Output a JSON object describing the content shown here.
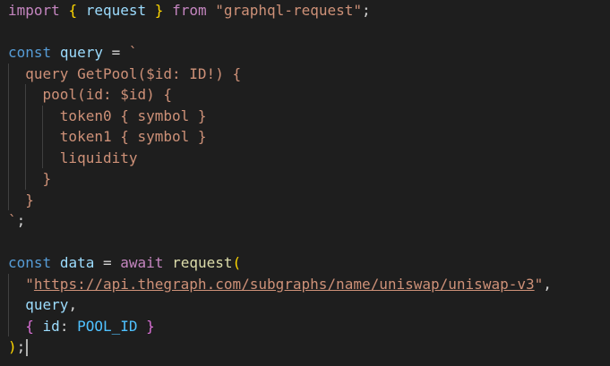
{
  "editor": {
    "language": "javascript",
    "theme": "dark",
    "colors": {
      "background": "#1e1e1e",
      "keyword_control": "#c586c0",
      "keyword_storage": "#569cd6",
      "variable": "#9cdcfe",
      "constant": "#4fc1ff",
      "function": "#dcdcaa",
      "string": "#ce9178",
      "bracket_level1": "#ffd700",
      "bracket_level2": "#da70d6"
    },
    "lines": [
      {
        "indent_guides": 0,
        "tokens": [
          {
            "t": "import",
            "c": "kw"
          },
          {
            "t": " ",
            "c": "punc"
          },
          {
            "t": "{",
            "c": "br1"
          },
          {
            "t": " ",
            "c": "punc"
          },
          {
            "t": "request",
            "c": "var"
          },
          {
            "t": " ",
            "c": "punc"
          },
          {
            "t": "}",
            "c": "br1"
          },
          {
            "t": " ",
            "c": "punc"
          },
          {
            "t": "from",
            "c": "kw"
          },
          {
            "t": " ",
            "c": "punc"
          },
          {
            "t": "\"graphql-request\"",
            "c": "str"
          },
          {
            "t": ";",
            "c": "punc"
          }
        ]
      },
      {
        "indent_guides": 0,
        "tokens": []
      },
      {
        "indent_guides": 0,
        "tokens": [
          {
            "t": "const",
            "c": "kw2"
          },
          {
            "t": " ",
            "c": "punc"
          },
          {
            "t": "query",
            "c": "var"
          },
          {
            "t": " = ",
            "c": "punc"
          },
          {
            "t": "`",
            "c": "str"
          }
        ]
      },
      {
        "indent_guides": 1,
        "tokens": [
          {
            "t": "  query GetPool($id: ID!) {",
            "c": "str"
          }
        ]
      },
      {
        "indent_guides": 2,
        "tokens": [
          {
            "t": "    pool(id: $id) {",
            "c": "str"
          }
        ]
      },
      {
        "indent_guides": 3,
        "tokens": [
          {
            "t": "      token0 { symbol }",
            "c": "str"
          }
        ]
      },
      {
        "indent_guides": 3,
        "tokens": [
          {
            "t": "      token1 { symbol }",
            "c": "str"
          }
        ]
      },
      {
        "indent_guides": 3,
        "tokens": [
          {
            "t": "      liquidity",
            "c": "str"
          }
        ]
      },
      {
        "indent_guides": 2,
        "tokens": [
          {
            "t": "    }",
            "c": "str"
          }
        ]
      },
      {
        "indent_guides": 1,
        "tokens": [
          {
            "t": "  }",
            "c": "str"
          }
        ]
      },
      {
        "indent_guides": 0,
        "tokens": [
          {
            "t": "`",
            "c": "str"
          },
          {
            "t": ";",
            "c": "punc"
          }
        ]
      },
      {
        "indent_guides": 0,
        "tokens": []
      },
      {
        "indent_guides": 0,
        "tokens": [
          {
            "t": "const",
            "c": "kw2"
          },
          {
            "t": " ",
            "c": "punc"
          },
          {
            "t": "data",
            "c": "var"
          },
          {
            "t": " = ",
            "c": "punc"
          },
          {
            "t": "await",
            "c": "kw"
          },
          {
            "t": " ",
            "c": "punc"
          },
          {
            "t": "request",
            "c": "fn"
          },
          {
            "t": "(",
            "c": "br1"
          }
        ]
      },
      {
        "indent_guides": 1,
        "tokens": [
          {
            "t": "  ",
            "c": "punc"
          },
          {
            "t": "\"",
            "c": "str"
          },
          {
            "t": "https://api.thegraph.com/subgraphs/name/uniswap/uniswap-v3",
            "c": "str url"
          },
          {
            "t": "\"",
            "c": "str"
          },
          {
            "t": ",",
            "c": "punc"
          }
        ]
      },
      {
        "indent_guides": 1,
        "tokens": [
          {
            "t": "  ",
            "c": "punc"
          },
          {
            "t": "query",
            "c": "var"
          },
          {
            "t": ",",
            "c": "punc"
          }
        ]
      },
      {
        "indent_guides": 1,
        "tokens": [
          {
            "t": "  ",
            "c": "punc"
          },
          {
            "t": "{",
            "c": "br2"
          },
          {
            "t": " ",
            "c": "punc"
          },
          {
            "t": "id",
            "c": "var"
          },
          {
            "t": ": ",
            "c": "punc"
          },
          {
            "t": "POOL_ID",
            "c": "const"
          },
          {
            "t": " ",
            "c": "punc"
          },
          {
            "t": "}",
            "c": "br2"
          }
        ]
      },
      {
        "indent_guides": 0,
        "cursor_after": true,
        "tokens": [
          {
            "t": ")",
            "c": "br1"
          },
          {
            "t": ";",
            "c": "punc"
          }
        ]
      }
    ]
  }
}
